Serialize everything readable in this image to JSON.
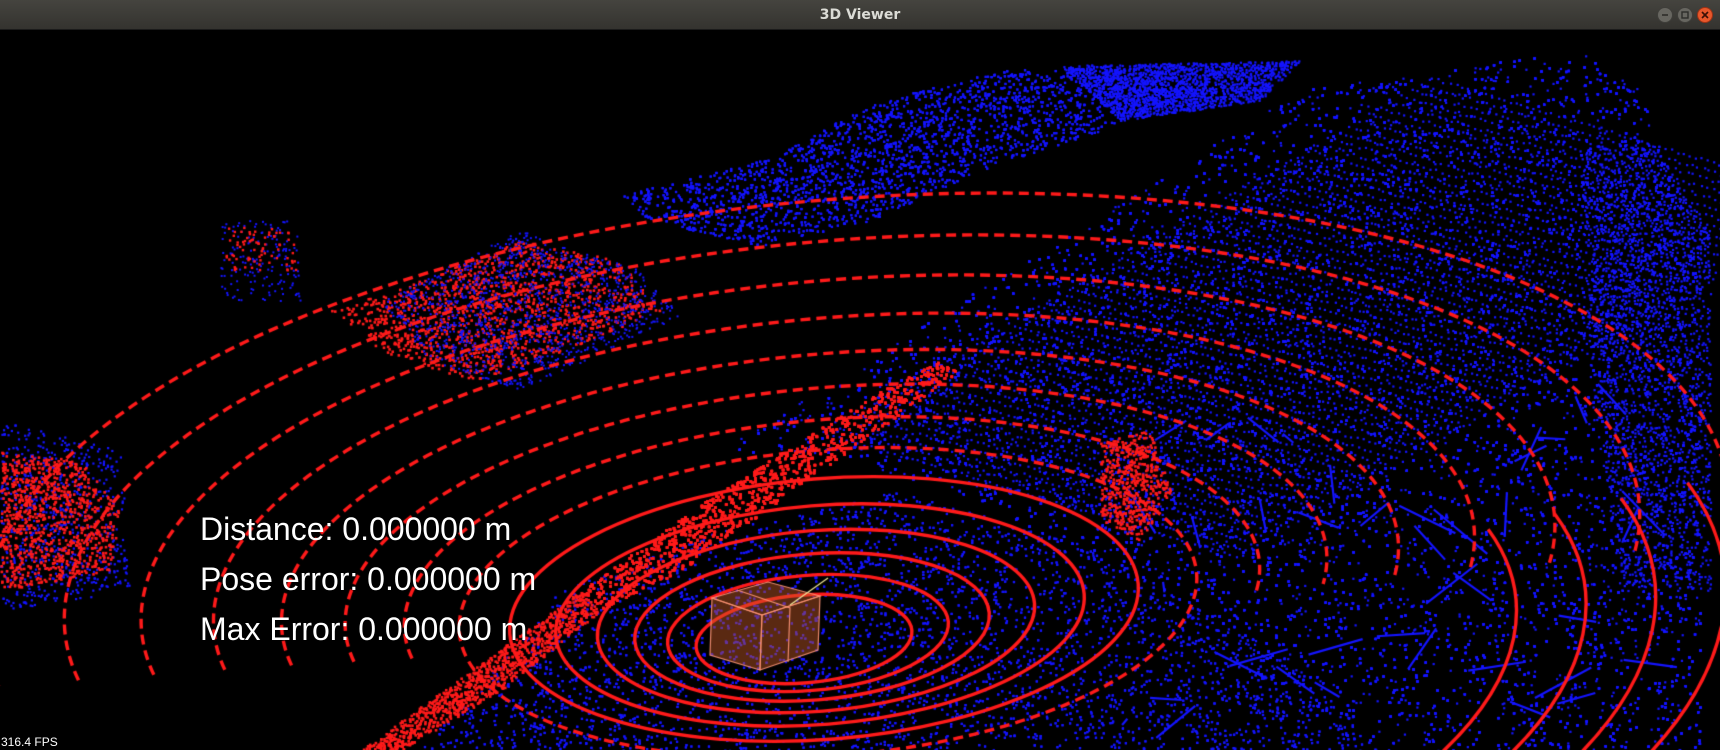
{
  "window": {
    "title": "3D Viewer",
    "controls": {
      "minimize": "minimize-icon",
      "maximize": "maximize-icon",
      "close": "close-icon"
    }
  },
  "viewer": {
    "stats": {
      "distance": "Distance: 0.000000 m",
      "pose_error": "Pose error: 0.000000 m",
      "max_error": "Max Error: 0.000000 m"
    },
    "fps": "316.4 FPS"
  },
  "colors": {
    "background": "#000000",
    "map_points": "#1414ff",
    "scan_points": "#ff1a1a",
    "vehicle_box": "#c85a2a",
    "titlebar": "#3c3b37",
    "close_button": "#e7572b"
  }
}
